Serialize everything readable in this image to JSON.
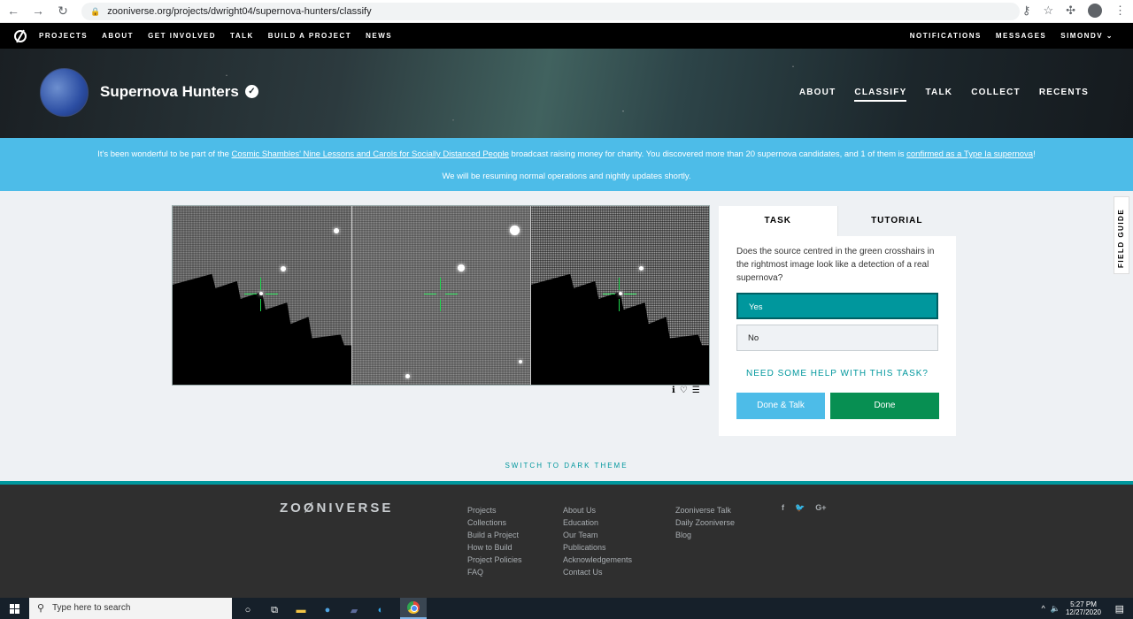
{
  "browser": {
    "url": "zooniverse.org/projects/dwright04/supernova-hunters/classify"
  },
  "topnav": {
    "left": [
      "PROJECTS",
      "ABOUT",
      "GET INVOLVED",
      "TALK",
      "BUILD A PROJECT",
      "NEWS"
    ],
    "right": [
      "NOTIFICATIONS",
      "MESSAGES",
      "SIMONDV ⌄"
    ]
  },
  "project": {
    "title": "Supernova Hunters",
    "nav": [
      "ABOUT",
      "CLASSIFY",
      "TALK",
      "COLLECT",
      "RECENTS"
    ],
    "active_nav": "CLASSIFY"
  },
  "announcement": {
    "line1_pre": "It's been wonderful to be part of the ",
    "line1_link1": "Cosmic Shambles' Nine Lessons and Carols for Socially Distanced People",
    "line1_mid": " broadcast raising money for charity. You discovered more than 20 supernova candidates, and 1 of them is ",
    "line1_link2": "confirmed as a Type Ia supernova",
    "line1_post": "!",
    "line2": "We will be resuming normal operations and nightly updates shortly."
  },
  "task": {
    "tab_task": "TASK",
    "tab_tutorial": "TUTORIAL",
    "question": "Does the source centred in the green crosshairs in the rightmost image look like a detection of a real supernova?",
    "answer_yes": "Yes",
    "answer_no": "No",
    "help": "NEED SOME HELP WITH THIS TASK?",
    "done_talk": "Done & Talk",
    "done": "Done"
  },
  "field_guide": "FIELD GUIDE",
  "dark_theme": "SWITCH TO DARK THEME",
  "footer": {
    "logo": "ZOØNIVERSE",
    "col1": [
      "Projects",
      "Collections",
      "Build a Project",
      "How to Build",
      "Project Policies",
      "FAQ"
    ],
    "col2": [
      "About Us",
      "Education",
      "Our Team",
      "Publications",
      "Acknowledgements",
      "Contact Us"
    ],
    "col3": [
      "Zooniverse Talk",
      "Daily Zooniverse",
      "Blog"
    ],
    "social": [
      "f",
      "🐦",
      "G+"
    ]
  },
  "taskbar": {
    "search_placeholder": "Type here to search",
    "time": "5:27 PM",
    "date": "12/27/2020"
  }
}
